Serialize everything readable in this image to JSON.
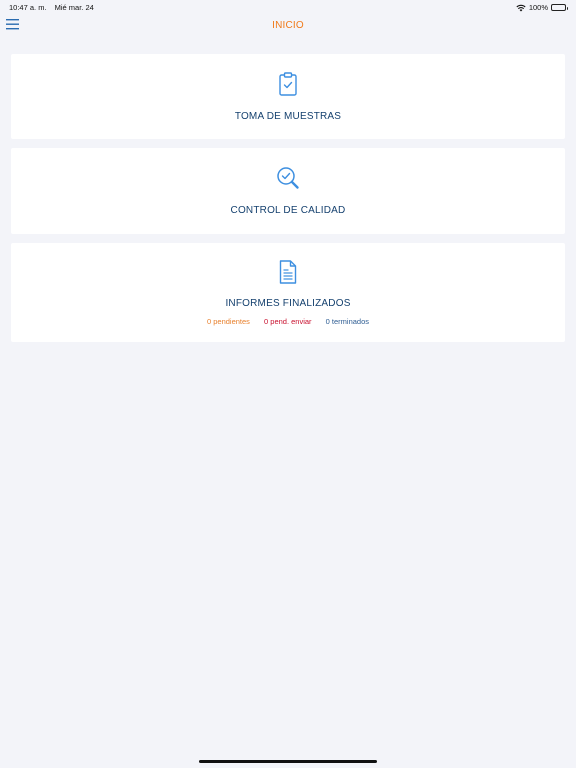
{
  "status_bar": {
    "time": "10:47 a. m.",
    "date": "Mié mar. 24",
    "battery_percent": "100%"
  },
  "nav": {
    "title": "INICIO",
    "menu_icon": "hamburger-menu-icon"
  },
  "cards": [
    {
      "title": "TOMA DE MUESTRAS",
      "icon": "clipboard-check-icon"
    },
    {
      "title": "CONTROL DE CALIDAD",
      "icon": "magnifier-check-icon"
    },
    {
      "title": "INFORMES FINALIZADOS",
      "icon": "document-icon",
      "stats": {
        "pending": "0 pendientes",
        "pending_send": "0 pend. enviar",
        "finished": "0 terminados"
      }
    }
  ],
  "colors": {
    "accent": "#f07a1a",
    "primary_text": "#14406e",
    "icon_blue": "#3d8fe0",
    "background": "#f3f4f9",
    "pending": "#e8802d",
    "pending_send": "#c8102e",
    "finished": "#2e5d93"
  }
}
